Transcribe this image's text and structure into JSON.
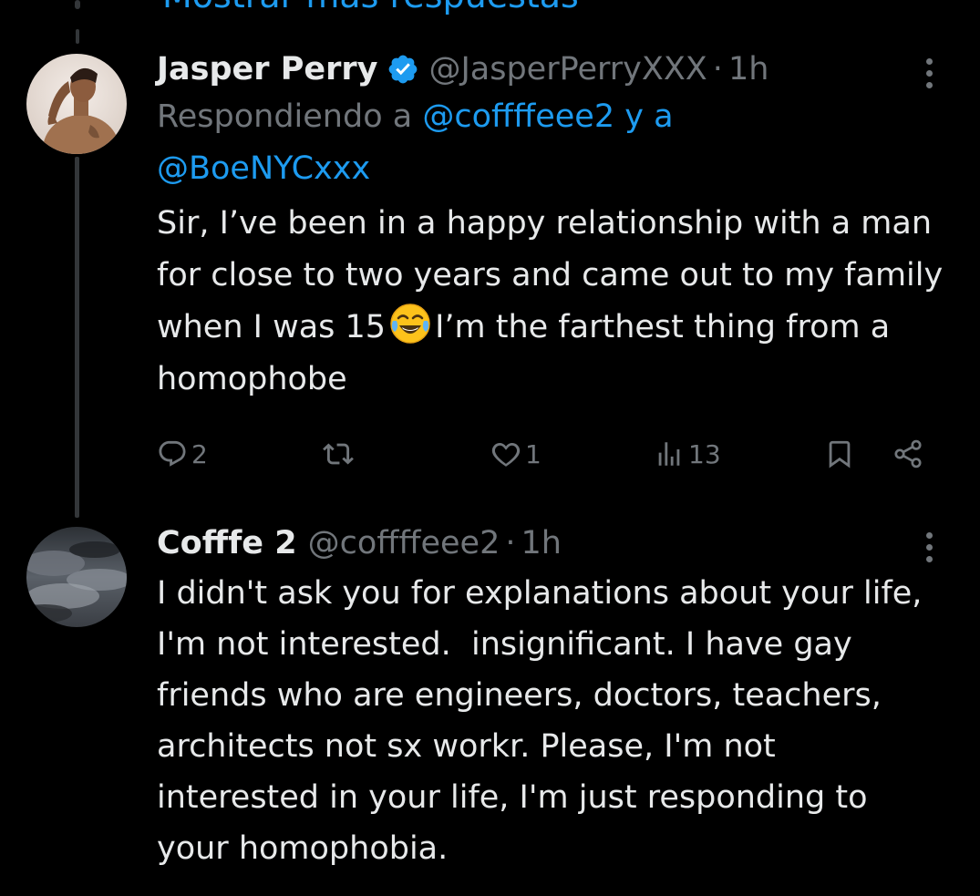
{
  "thread": {
    "show_more_label": "Mostrar más respuestas"
  },
  "tweets": [
    {
      "display_name": "Jasper Perry",
      "verified": true,
      "handle": "@JasperPerryXXX",
      "separator": "·",
      "time": "1h",
      "replying_prefix": "Respondiendo a",
      "replying_to_1": "@coffffeee2",
      "replying_joiner": "y a",
      "replying_to_2": "@BoeNYCxxx",
      "text_before_emoji": "Sir, I’ve been in a happy relationship with a man for close to two years and came out to my family when I was 15",
      "emoji": "face-with-tears-of-joy",
      "text_after_emoji": "I’m the farthest thing from a homophobe",
      "actions": {
        "replies": "2",
        "retweets": "",
        "likes": "1",
        "views": "13"
      }
    },
    {
      "display_name": "Cofffe 2",
      "handle": "@coffffeee2",
      "separator": "·",
      "time": "1h",
      "text": "I didn't ask you for explanations about your life, I'm not interested.  insignificant. I have gay friends who are engineers, doctors, teachers, architects not sx workr. Please, I'm not interested in your life, I'm just responding to your homophobia."
    }
  ],
  "colors": {
    "background": "#000000",
    "text_primary": "#e7e9ea",
    "text_secondary": "#71767b",
    "accent": "#1d9bf0",
    "thread_line": "#333639"
  }
}
